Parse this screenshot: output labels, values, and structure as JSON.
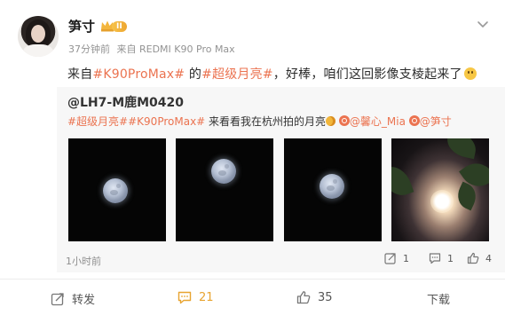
{
  "user": {
    "name": "笋寸",
    "badge": "II",
    "time": "37分钟前",
    "source": "来自 REDMI K90 Pro Max"
  },
  "post": {
    "prefix": "来自",
    "tag1": "#K90ProMax#",
    "middle": " 的",
    "tag2": "#超级月亮#",
    "suffix": "，好棒，咱们这回影像支棱起来了"
  },
  "repost": {
    "author": "@LH7-M鹿M0420",
    "tag1": "#超级月亮#",
    "tag2": "#K90ProMax#",
    "text": " 来看看我在杭州拍的月亮",
    "mention1": "@馨心_Mia",
    "mention2": "@笋寸",
    "time": "1小时前",
    "actions": {
      "repost": "1",
      "comment": "1",
      "like": "4"
    }
  },
  "actions": {
    "repost": "转发",
    "comment": "21",
    "like": "35",
    "more": "下载"
  },
  "colors": {
    "accent": "#eb7350",
    "highlight": "#e8a430"
  }
}
